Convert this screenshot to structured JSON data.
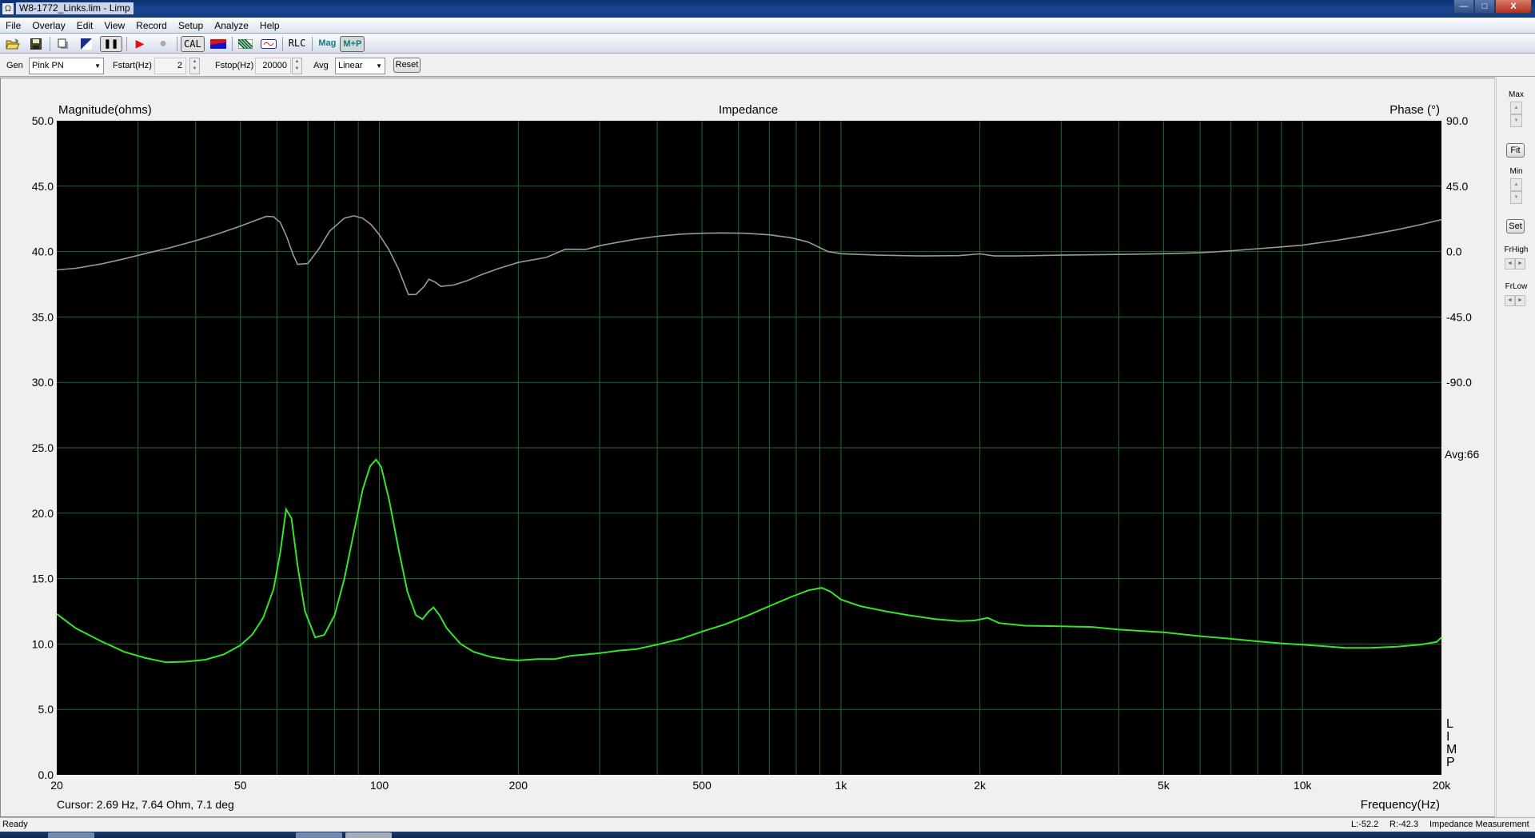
{
  "window": {
    "title": "W8-1772_Links.lim - Limp",
    "app_icon": "Ω",
    "minimize": "—",
    "maximize": "□",
    "close": "X"
  },
  "menu": [
    "File",
    "Overlay",
    "Edit",
    "View",
    "Record",
    "Setup",
    "Analyze",
    "Help"
  ],
  "toolbar": {
    "open_icon": "open-folder-icon",
    "save_icon": "save-disk-icon",
    "copy_icon": "copy-icon",
    "levels_icon": "levels-icon",
    "pause_label": "❚❚",
    "play_label": "▶",
    "record_label": "●",
    "cal_label": "CAL",
    "rlc_label": "RLC",
    "mag_label": "Mag",
    "mp_label": "M+P"
  },
  "controls": {
    "gen_label": "Gen",
    "gen_value": "Pink PN",
    "fstart_label": "Fstart(Hz)",
    "fstart_value": "2",
    "fstop_label": "Fstop(Hz)",
    "fstop_value": "20000",
    "avg_label": "Avg",
    "avg_value": "Linear",
    "reset_label": "Reset"
  },
  "side": {
    "max_label": "Max",
    "fit_label": "Fit",
    "min_label": "Min",
    "set_label": "Set",
    "frhigh_label": "FrHigh",
    "frlow_label": "FrLow",
    "up": "▲",
    "down": "▼",
    "left": "◄",
    "right": "►"
  },
  "chart_data": {
    "type": "line",
    "title": "Impedance",
    "ylabel": "Magnitude(ohms)",
    "y2label": "Phase (°)",
    "xlabel": "Frequency(Hz)",
    "xscale": "log",
    "xlim": [
      20,
      20000
    ],
    "ylim": [
      0,
      50
    ],
    "y2lim": [
      -90,
      90
    ],
    "y2_axis_span": [
      -315,
      90
    ],
    "grid": true,
    "background": "#000000",
    "grid_color": "#1f6b2a",
    "x_ticks": [
      {
        "value": 20,
        "label": "20"
      },
      {
        "value": 50,
        "label": "50"
      },
      {
        "value": 100,
        "label": "100"
      },
      {
        "value": 200,
        "label": "200"
      },
      {
        "value": 500,
        "label": "500"
      },
      {
        "value": 1000,
        "label": "1k"
      },
      {
        "value": 2000,
        "label": "2k"
      },
      {
        "value": 5000,
        "label": "5k"
      },
      {
        "value": 10000,
        "label": "10k"
      },
      {
        "value": 20000,
        "label": "20k"
      }
    ],
    "x_minor_grid": [
      30,
      40,
      60,
      70,
      80,
      90,
      300,
      400,
      600,
      700,
      800,
      900,
      3000,
      4000,
      6000,
      7000,
      8000,
      9000
    ],
    "y_ticks": [
      "0.0",
      "5.0",
      "10.0",
      "15.0",
      "20.0",
      "25.0",
      "30.0",
      "35.0",
      "40.0",
      "45.0",
      "50.0"
    ],
    "y2_ticks": [
      {
        "value": 90,
        "label": "90.0"
      },
      {
        "value": 45,
        "label": "45.0"
      },
      {
        "value": 0,
        "label": "0.0"
      },
      {
        "value": -45,
        "label": "-45.0"
      },
      {
        "value": -90,
        "label": "-90.0"
      }
    ],
    "annotation_avg": "Avg:66",
    "watermark": [
      "L",
      "I",
      "M",
      "P"
    ],
    "series": [
      {
        "name": "Magnitude",
        "axis": "left",
        "color": "#33e62a",
        "x": [
          20,
          22,
          25,
          28,
          31,
          34.5,
          38,
          42,
          46,
          50,
          53,
          56,
          59,
          61,
          62.8,
          64.5,
          66.5,
          69,
          72.6,
          76,
          80,
          84,
          88,
          92,
          95.5,
          98.4,
          101,
          105,
          110,
          115,
          120,
          124,
          128,
          131,
          135,
          140,
          150,
          160,
          175,
          190,
          200,
          220,
          240,
          260,
          280,
          300,
          330,
          360,
          400,
          450,
          500,
          560,
          630,
          700,
          780,
          850,
          908,
          950,
          1000,
          1100,
          1250,
          1400,
          1600,
          1800,
          1950,
          2080,
          2200,
          2500,
          3000,
          3500,
          4000,
          5000,
          6000,
          7000,
          8000,
          9000,
          10000,
          11000,
          12400,
          14000,
          16000,
          18000,
          19500,
          20000
        ],
        "y": [
          12.3,
          11.2,
          10.2,
          9.4,
          8.95,
          8.6,
          8.65,
          8.8,
          9.2,
          9.9,
          10.7,
          12.0,
          14.2,
          17.0,
          20.3,
          19.6,
          16.0,
          12.5,
          10.5,
          10.7,
          12.2,
          15.0,
          18.5,
          21.8,
          23.6,
          24.1,
          23.5,
          21.0,
          17.3,
          14.0,
          12.2,
          11.9,
          12.5,
          12.8,
          12.2,
          11.2,
          10.0,
          9.4,
          9.0,
          8.8,
          8.75,
          8.85,
          8.85,
          9.1,
          9.2,
          9.3,
          9.5,
          9.6,
          9.95,
          10.4,
          10.95,
          11.5,
          12.2,
          12.9,
          13.6,
          14.1,
          14.3,
          14.0,
          13.4,
          12.9,
          12.5,
          12.2,
          11.9,
          11.75,
          11.8,
          12.0,
          11.6,
          11.4,
          11.35,
          11.3,
          11.1,
          10.9,
          10.6,
          10.4,
          10.2,
          10.05,
          9.95,
          9.85,
          9.7,
          9.7,
          9.8,
          9.95,
          10.15,
          10.5
        ]
      },
      {
        "name": "Phase",
        "axis": "right",
        "color": "#9a9a9a",
        "x": [
          20,
          22,
          25,
          28,
          31,
          35,
          40,
          45,
          50,
          54,
          56.9,
          59,
          61,
          63,
          65,
          66.5,
          70,
          74,
          78,
          84,
          88,
          92,
          96,
          100,
          105,
          110,
          115.6,
          120,
          125,
          128,
          132,
          136,
          145,
          155,
          166,
          180,
          200,
          230,
          253,
          280,
          300,
          330,
          360,
          400,
          450,
          500,
          550,
          620,
          700,
          780,
          850,
          937,
          1000,
          1200,
          1500,
          1800,
          2000,
          2150,
          2400,
          3000,
          4000,
          5000,
          6000,
          7000,
          8000,
          9000,
          10000,
          12000,
          14000,
          16000,
          18000,
          20000
        ],
        "y": [
          -12.6,
          -11.5,
          -8.5,
          -5.0,
          -1.5,
          2.5,
          7.5,
          12.5,
          17.5,
          21.5,
          24.2,
          24.0,
          20.0,
          10.0,
          -2.0,
          -8.8,
          -8.2,
          2.0,
          14.0,
          23.0,
          24.6,
          23.0,
          18.5,
          11.5,
          1.0,
          -12.0,
          -29.6,
          -29.5,
          -24.0,
          -19.0,
          -21.0,
          -24.0,
          -23.0,
          -20.0,
          -16.0,
          -12.0,
          -7.5,
          -4.0,
          1.6,
          1.5,
          4.0,
          6.5,
          8.5,
          10.5,
          12.0,
          12.6,
          12.8,
          12.6,
          11.5,
          9.5,
          6.5,
          0.0,
          -1.5,
          -2.5,
          -3.0,
          -2.8,
          -1.6,
          -3.0,
          -3.0,
          -2.5,
          -2.0,
          -1.5,
          -0.8,
          0.5,
          2.0,
          3.2,
          4.4,
          8.0,
          11.5,
          15.0,
          18.5,
          22.0
        ]
      }
    ]
  },
  "cursor_readout": "Cursor: 2.69 Hz, 7.64 Ohm, 7.1 deg",
  "status": {
    "left": "Ready",
    "level_l": "L:-52.2",
    "level_r": "R:-42.3",
    "mode": "Impedance Measurement"
  }
}
